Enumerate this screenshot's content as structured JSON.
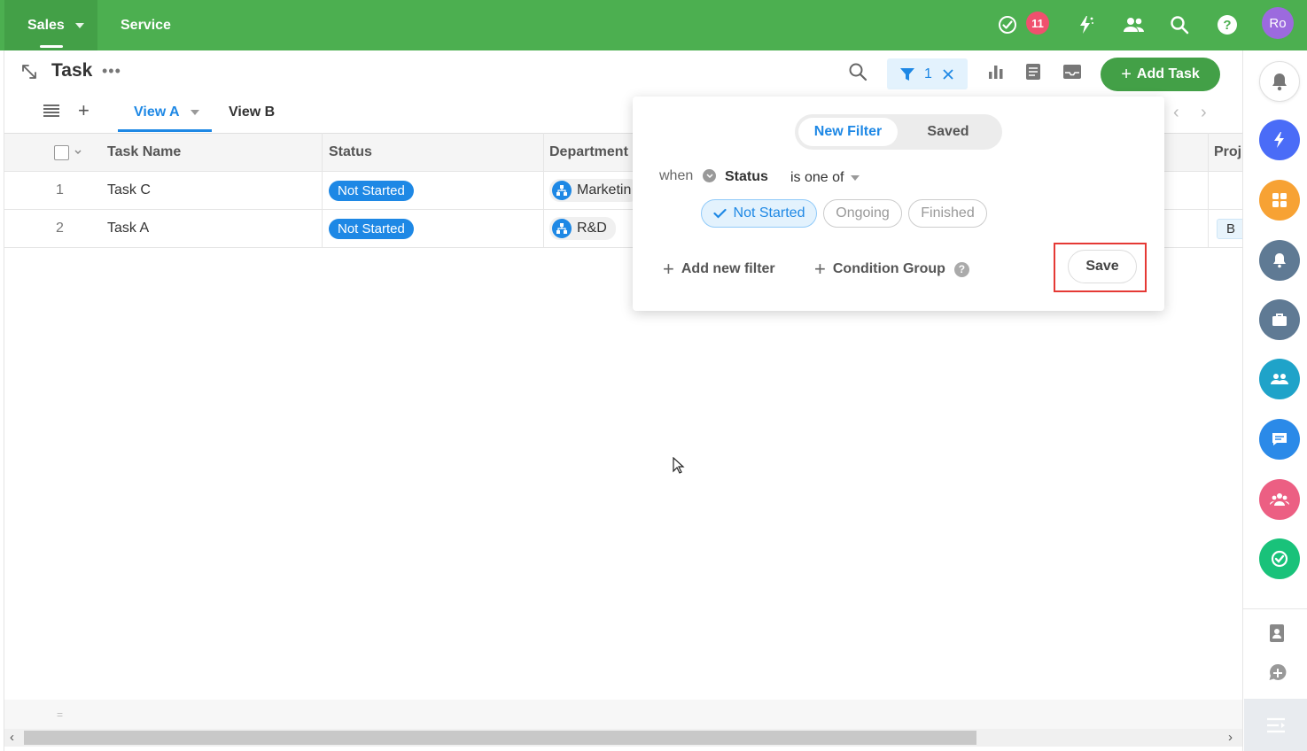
{
  "topbar": {
    "apps": [
      "Sales",
      "Service"
    ],
    "notification_count": "11",
    "avatar_initials": "Ro",
    "icons": [
      "tasks-check-icon",
      "magic-bolt-icon",
      "people-icon",
      "search-icon",
      "help-icon"
    ]
  },
  "header": {
    "title": "Task",
    "filter_count": "1",
    "add_task_label": "Add Task"
  },
  "views": {
    "tabs": [
      "View A",
      "View B"
    ]
  },
  "table": {
    "columns": [
      "Task Name",
      "Status",
      "Department",
      "Proj"
    ],
    "rows": [
      {
        "index": "1",
        "name": "Task C",
        "status": "Not Started",
        "department": "Marketin",
        "project": ""
      },
      {
        "index": "2",
        "name": "Task A",
        "status": "Not Started",
        "department": "R&D",
        "project": "B"
      }
    ]
  },
  "filter_popover": {
    "tabs": {
      "new": "New Filter",
      "saved": "Saved"
    },
    "when_label": "when",
    "field": "Status",
    "operator": "is one of",
    "options": [
      {
        "label": "Not Started",
        "selected": true
      },
      {
        "label": "Ongoing",
        "selected": false
      },
      {
        "label": "Finished",
        "selected": false
      }
    ],
    "add_filter_label": "Add new filter",
    "condition_group_label": "Condition Group",
    "save_label": "Save"
  },
  "sidebar_apps": [
    {
      "name": "bolt-app",
      "color": "#4a6cf7"
    },
    {
      "name": "grid-app",
      "color": "#f7a234"
    },
    {
      "name": "bell-app",
      "color": "#5f7a94"
    },
    {
      "name": "briefcase-app",
      "color": "#5f7a94"
    },
    {
      "name": "team-app",
      "color": "#1fa3c9"
    },
    {
      "name": "chat-app",
      "color": "#2b8ae8"
    },
    {
      "name": "group-app",
      "color": "#ec5f83"
    },
    {
      "name": "check-app",
      "color": "#19c27a"
    }
  ],
  "colors": {
    "topbar": "#4caf50",
    "accent": "#1e88e5",
    "primary_button": "#43a047",
    "badge": "#f0506e",
    "highlight_outline": "#e53935"
  }
}
